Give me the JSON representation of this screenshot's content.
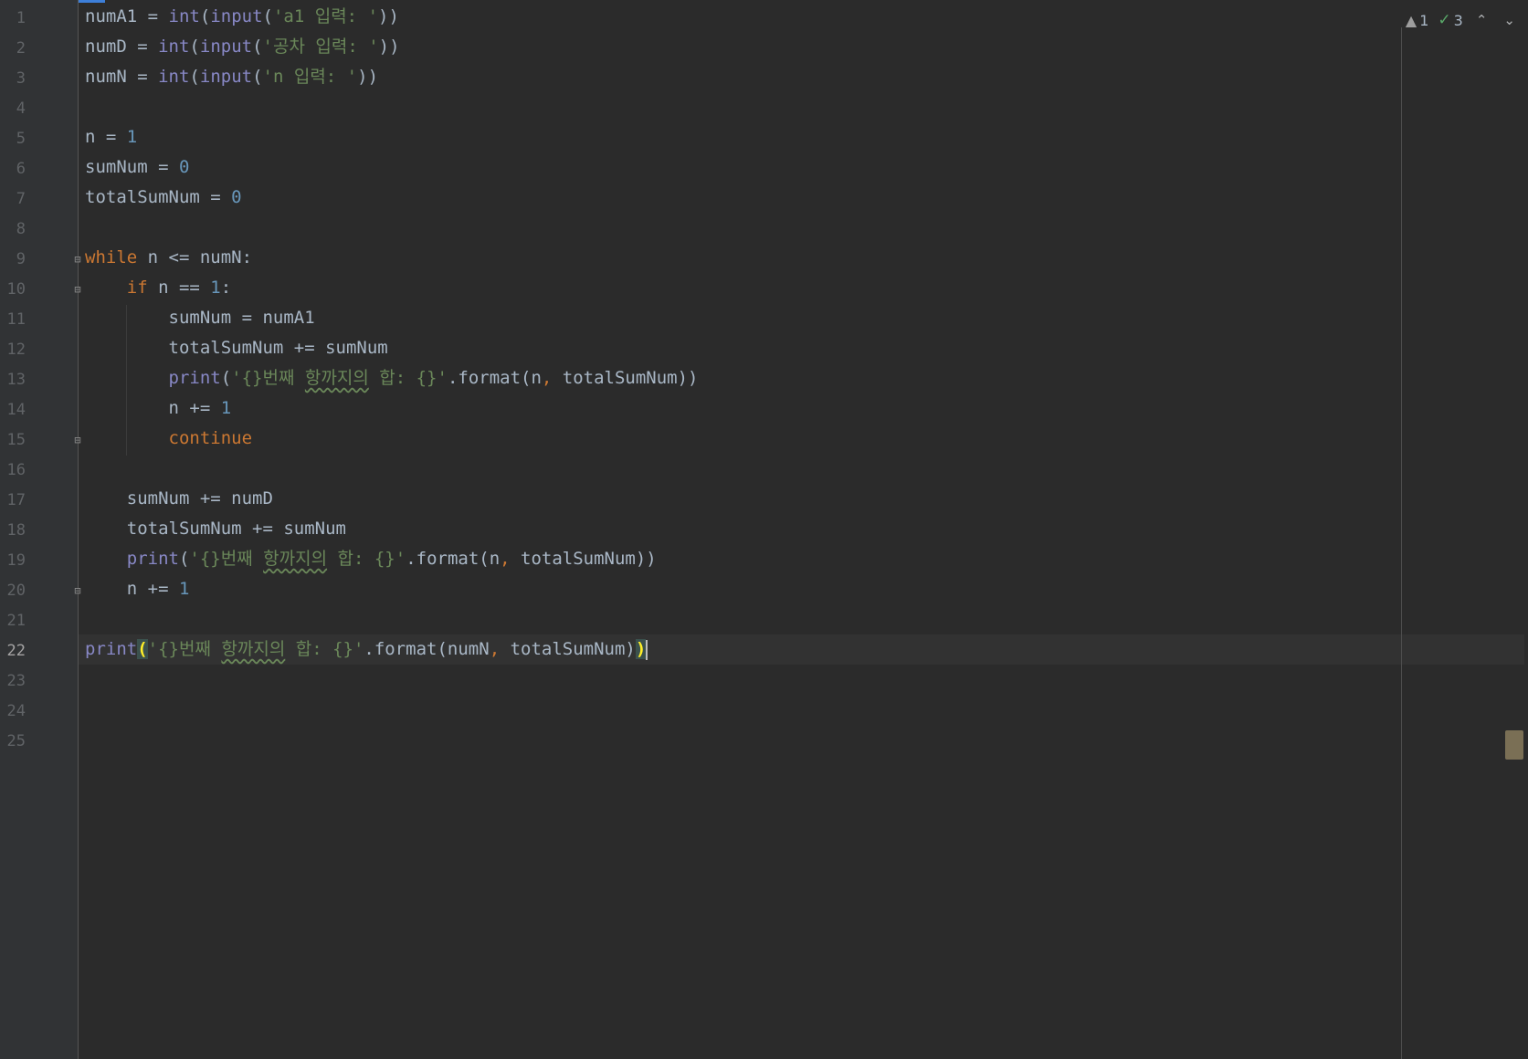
{
  "editor": {
    "line_numbers": [
      "1",
      "2",
      "3",
      "4",
      "5",
      "6",
      "7",
      "8",
      "9",
      "10",
      "11",
      "12",
      "13",
      "14",
      "15",
      "16",
      "17",
      "18",
      "19",
      "20",
      "21",
      "22",
      "23",
      "24",
      "25"
    ],
    "current_line": "22",
    "inspection": {
      "warning_count": "1",
      "ok_count": "3",
      "prev_symbol": "⌃",
      "next_symbol": "⌄"
    }
  },
  "code": {
    "l1": {
      "var": "numA1",
      "eq": " = ",
      "int": "int",
      "p1": "(",
      "input": "input",
      "p2": "(",
      "str": "'a1 입력: '",
      "p3": "))"
    },
    "l2": {
      "var": "numD",
      "eq": " = ",
      "int": "int",
      "p1": "(",
      "input": "input",
      "p2": "(",
      "str": "'공차 입력: '",
      "p3": "))"
    },
    "l3": {
      "var": "numN",
      "eq": " = ",
      "int": "int",
      "p1": "(",
      "input": "input",
      "p2": "(",
      "str": "'n 입력: '",
      "p3": "))"
    },
    "l5": {
      "text": "n = ",
      "num": "1"
    },
    "l6": {
      "text": "sumNum = ",
      "num": "0"
    },
    "l7": {
      "text": "totalSumNum = ",
      "num": "0"
    },
    "l9": {
      "kw": "while",
      "rest": " n <= numN:"
    },
    "l10": {
      "indent": "    ",
      "kw": "if",
      "rest": " n == ",
      "num": "1",
      "colon": ":"
    },
    "l11": {
      "indent": "        ",
      "text": "sumNum = numA1"
    },
    "l12": {
      "indent": "        ",
      "text": "totalSumNum += sumNum"
    },
    "l13": {
      "indent": "        ",
      "fn": "print",
      "p1": "(",
      "s1": "'{}번째 ",
      "s2": "항까지의",
      "s3": " 합: {}'",
      "fmt": ".format(n",
      "comma": ",",
      "rest": " totalSumNum))"
    },
    "l14": {
      "indent": "        ",
      "text": "n += ",
      "num": "1"
    },
    "l15": {
      "indent": "        ",
      "kw": "continue"
    },
    "l17": {
      "indent": "    ",
      "text": "sumNum += numD"
    },
    "l18": {
      "indent": "    ",
      "text": "totalSumNum += sumNum"
    },
    "l19": {
      "indent": "    ",
      "fn": "print",
      "p1": "(",
      "s1": "'{}번째 ",
      "s2": "항까지의",
      "s3": " 합: {}'",
      "fmt": ".format(n",
      "comma": ",",
      "rest": " totalSumNum))"
    },
    "l20": {
      "indent": "    ",
      "text": "n += ",
      "num": "1"
    },
    "l22": {
      "fn": "print",
      "p1": "(",
      "s1": "'{}번째 ",
      "s2": "항까지의",
      "s3": " 합: {}'",
      "fmt": ".format(numN",
      "comma": ",",
      "rest": " totalSumNum)",
      "p_end": ")"
    }
  },
  "colors": {
    "background": "#2b2b2b",
    "keyword": "#cc7832",
    "builtin": "#8888c6",
    "number": "#6897bb",
    "string": "#6a8759",
    "identifier": "#a9b7c6"
  }
}
